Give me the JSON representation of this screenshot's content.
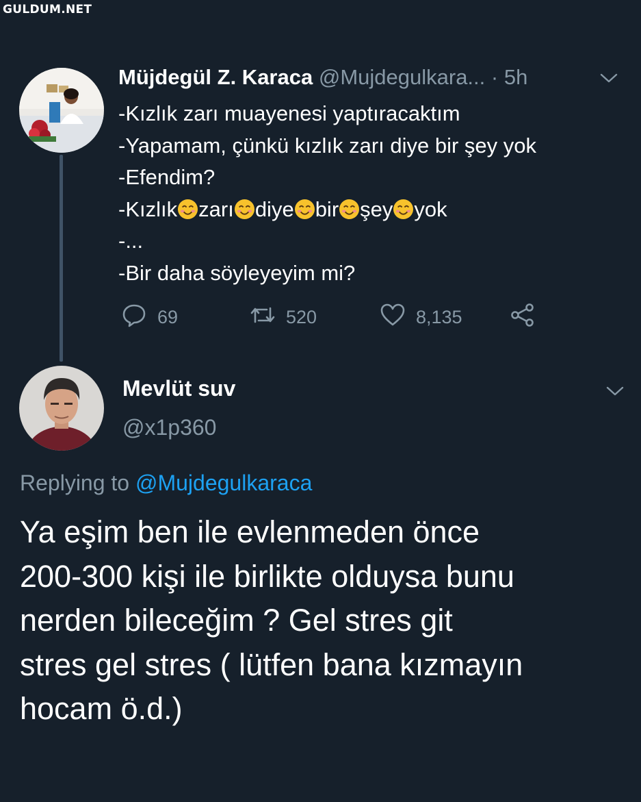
{
  "watermark": "GULDUM.NET",
  "tweet": {
    "author_name": "Müjdegül Z. Karaca",
    "author_handle": "@Mujdegulkara...",
    "time": "· 5h",
    "lines": [
      "-Kızlık zarı muayenesi yaptıracaktım",
      "-Yapamam, çünkü kızlık zarı diye bir şey yok",
      "-Efendim?",
      "",
      "-...",
      "-Bir daha söyleyeyim mi?"
    ],
    "emoji_line": {
      "words": [
        "-Kızlık",
        "zarı",
        "diye",
        "bir",
        "şey",
        "yok"
      ],
      "emoji": "smiling-face-with-smiling-eyes"
    },
    "actions": {
      "reply_count": "69",
      "retweet_count": "520",
      "like_count": "8,135"
    }
  },
  "reply": {
    "author_name": "Mevlüt suv",
    "author_handle": "@x1p360",
    "replying_prefix": "Replying to",
    "replying_to": "@Mujdegulkaraca",
    "body_lines": [
      "Ya eşim ben ile evlenmeden önce",
      "200-300 kişi ile birlikte olduysa bunu",
      "nerden bileceğim ? Gel stres git",
      "stres gel stres ( lütfen bana kızmayın",
      "hocam ö.d.)"
    ]
  },
  "colors": {
    "background": "#16202b",
    "secondary_text": "#8899a6",
    "accent": "#1da1f2"
  }
}
